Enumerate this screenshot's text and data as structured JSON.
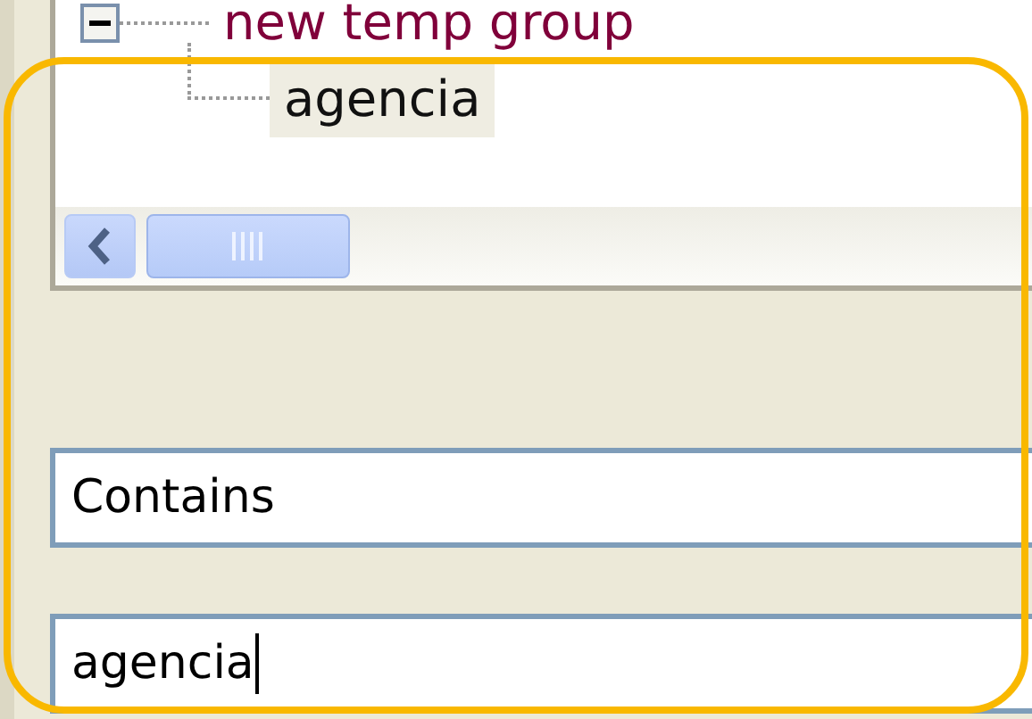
{
  "tree": [
    {
      "label": "new temp group",
      "expanded": true,
      "children": [
        {
          "label": "agencia",
          "selected": true
        }
      ]
    }
  ],
  "condition_field": {
    "value": "Contains"
  },
  "search_field": {
    "value": "agencia",
    "focused": true
  }
}
